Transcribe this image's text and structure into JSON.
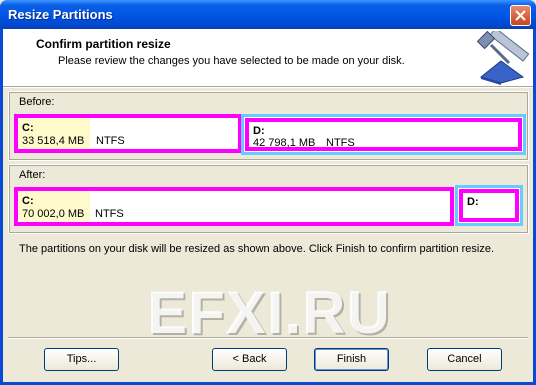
{
  "window": {
    "title": "Resize Partitions"
  },
  "header": {
    "title": "Confirm partition resize",
    "subtitle": "Please review the changes you have selected to be made on your disk.",
    "icon": "resize-tools-icon"
  },
  "before": {
    "label": "Before:",
    "partitions": [
      {
        "name": "C:",
        "size": "33 518,4 MB",
        "fs": "NTFS"
      },
      {
        "name": "D:",
        "size": "42 798,1 MB",
        "fs": "NTFS"
      }
    ]
  },
  "after": {
    "label": "After:",
    "partitions": [
      {
        "name": "C:",
        "size": "70 002,0 MB",
        "fs": "NTFS"
      },
      {
        "name": "D:"
      }
    ]
  },
  "message": "The partitions on your disk will be resized as shown above.  Click Finish to confirm partition resize.",
  "watermark": "EFXI.RU",
  "buttons": {
    "tips": "Tips...",
    "back": "< Back",
    "finish": "Finish",
    "cancel": "Cancel"
  },
  "colors": {
    "titlebar": "#0055e5",
    "partition_border": "#ff00ff",
    "extended_border": "#66ccff",
    "used_space": "#fffacb",
    "dialog_bg": "#ece9d8"
  }
}
